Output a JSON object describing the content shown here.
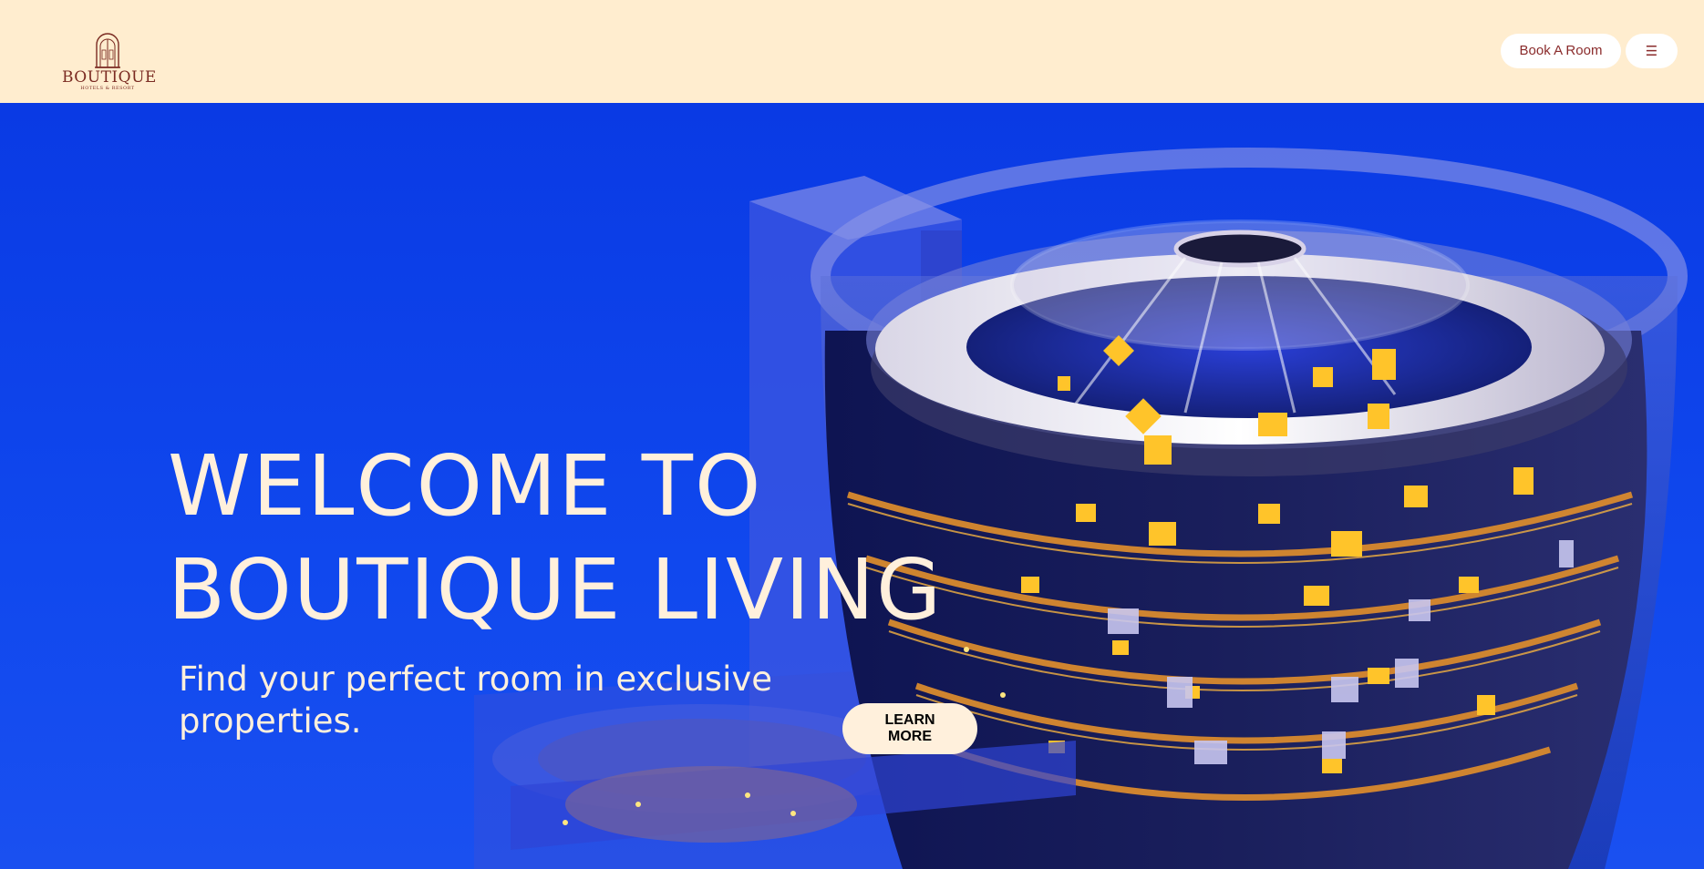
{
  "header": {
    "logo": {
      "wordmark": "BOUTIQUE",
      "tagline": "HOTELS & RESORT",
      "icon": "arched-door-icon"
    },
    "book_label": "Book A Room",
    "menu_icon": "hamburger-menu-icon",
    "menu_glyph": "☰"
  },
  "hero": {
    "title_line1": "WELCOME TO",
    "title_line2": "BOUTIQUE LIVING",
    "subtitle": "Find your perfect room in exclusive properties.",
    "cta_label": "LEARN MORE",
    "image_alt": "hotel-building-render"
  },
  "colors": {
    "header_bg": "#ffedcf",
    "hero_bg": "#0a3de8",
    "accent_text": "#fff0dc",
    "brand": "#7a2b22"
  }
}
